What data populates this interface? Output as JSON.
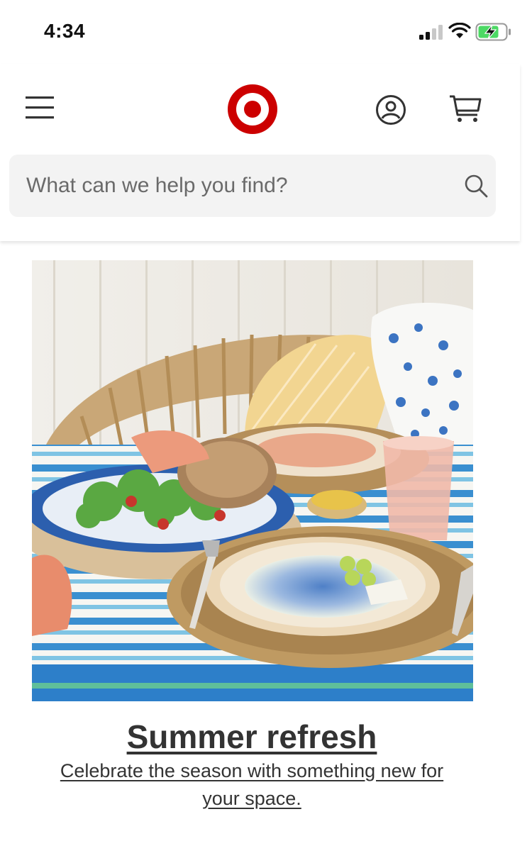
{
  "status_bar": {
    "time": "4:34"
  },
  "header": {
    "search": {
      "placeholder": "What can we help you find?"
    }
  },
  "promo": {
    "headline": "Summer refresh",
    "subtext": "Celebrate the season with something new for your space."
  },
  "colors": {
    "brand_red": "#cc0000",
    "text": "#333333",
    "search_bg": "#f3f3f3",
    "battery_charging": "#4cd964"
  },
  "icons": [
    "signal-icon",
    "wifi-icon",
    "battery-charging-icon",
    "hamburger-menu-icon",
    "target-logo",
    "account-icon",
    "cart-icon",
    "search-icon"
  ]
}
